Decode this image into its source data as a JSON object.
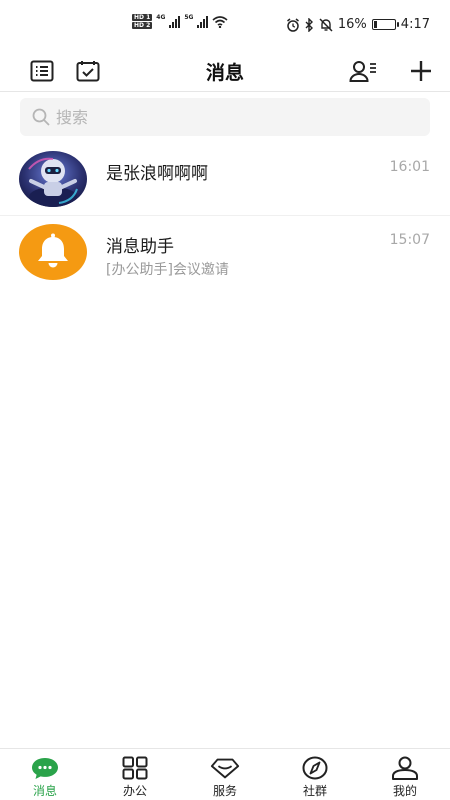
{
  "status_bar": {
    "hd1": "HD 1",
    "hd2": "HD 2",
    "net1": "4G",
    "net2": "5G",
    "battery": "16%",
    "battery_level": 0.16,
    "time": "4:17"
  },
  "header": {
    "title": "消息"
  },
  "search": {
    "placeholder": "搜索"
  },
  "conversations": [
    {
      "name": "是张浪啊啊啊",
      "preview": "",
      "time": "16:01",
      "avatar": "robot-avatar"
    },
    {
      "name": "消息助手",
      "preview": "[办公助手]会议邀请",
      "time": "15:07",
      "avatar": "bell-icon"
    }
  ],
  "tabbar": {
    "tabs": [
      {
        "label": "消息",
        "icon": "chat-bubble-icon",
        "active": true
      },
      {
        "label": "办公",
        "icon": "grid-icon",
        "active": false
      },
      {
        "label": "服务",
        "icon": "diamond-icon",
        "active": false
      },
      {
        "label": "社群",
        "icon": "compass-icon",
        "active": false
      },
      {
        "label": "我的",
        "icon": "user-icon",
        "active": false
      }
    ]
  },
  "colors": {
    "accent": "#2aa34a",
    "assistant_avatar": "#f59a12"
  }
}
